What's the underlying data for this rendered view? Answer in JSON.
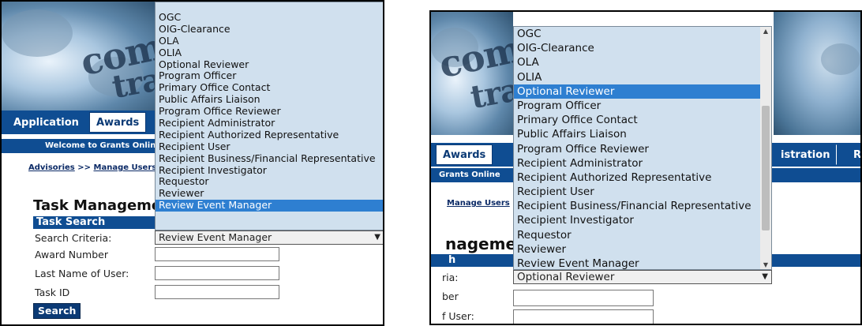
{
  "left": {
    "banner_words": [
      "com",
      "tra"
    ],
    "tabs": [
      "Application",
      "Awards"
    ],
    "welcome": "Welcome to Grants Online",
    "breadcrumb": {
      "first": "Advisories",
      "sep": ">>",
      "second": "Manage Users",
      "tail": ">"
    },
    "heading": "Task Manageme",
    "subbar": "Task Search",
    "labels": {
      "criteria": "Search Criteria:",
      "award": "Award Number",
      "lastname": "Last Name of User:",
      "taskid": "Task ID"
    },
    "select_value": "Review Event Manager",
    "search_button": "Search",
    "dropdown": [
      "OGC",
      "OIG-Clearance",
      "OLA",
      "OLIA",
      "Optional Reviewer",
      "Program Officer",
      "Primary Office Contact",
      "Public Affairs Liaison",
      "Program Office Reviewer",
      "Recipient Administrator",
      "Recipient Authorized Representative",
      "Recipient User",
      "Recipient Business/Financial Representative",
      "Recipient Investigator",
      "Requestor",
      "Reviewer",
      "Review Event Manager"
    ],
    "dropdown_selected": "Review Event Manager"
  },
  "right": {
    "banner_words": [
      "com",
      "tra"
    ],
    "tabs": [
      "Awards",
      "istration",
      "R"
    ],
    "welcome": "Grants Online",
    "breadcrumb": {
      "first": "Manage Users",
      "tail": ">"
    },
    "heading": "nageme",
    "subbar": "h",
    "labels": {
      "criteria": "ria:",
      "award": "ber",
      "lastname": "f User:"
    },
    "select_value": "Optional Reviewer",
    "dropdown": [
      "OGC",
      "OIG-Clearance",
      "OLA",
      "OLIA",
      "Optional Reviewer",
      "Program Officer",
      "Primary Office Contact",
      "Public Affairs Liaison",
      "Program Office Reviewer",
      "Recipient Administrator",
      "Recipient Authorized Representative",
      "Recipient User",
      "Recipient Business/Financial Representative",
      "Recipient Investigator",
      "Requestor",
      "Reviewer",
      "Review Event Manager"
    ],
    "dropdown_selected": "Optional Reviewer"
  },
  "icons": {
    "caret": "chevron-down-icon",
    "scroll_up": "scroll-up-arrow-icon",
    "scroll_down": "scroll-down-arrow-icon"
  },
  "colors": {
    "nav_blue": "#0f4d92",
    "dropdown_bg": "#d0e0ee",
    "selected": "#2e7fd1"
  }
}
